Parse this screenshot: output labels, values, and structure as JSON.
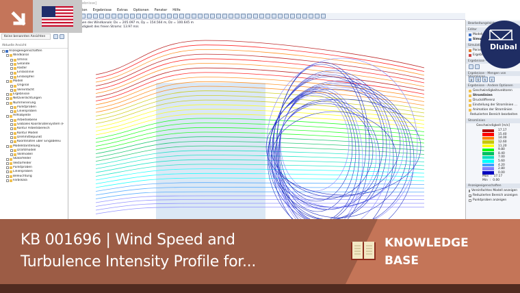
{
  "window": {
    "title_fragment": "ebnisse]"
  },
  "menu": [
    "tion",
    "Ergebnisse",
    "Extras",
    "Optionen",
    "Fenster",
    "Hilfe"
  ],
  "left_panel": {
    "views_select": "Keine benannten Ansichten",
    "section": "Aktuelle Ansicht",
    "tree": [
      {
        "label": "Anzeigeeigenschaften",
        "level": 0
      },
      {
        "label": "Windkanal",
        "level": 1
      },
      {
        "label": "Umriss",
        "level": 2
      },
      {
        "label": "Gelände",
        "level": 2
      },
      {
        "label": "Raster",
        "level": 2
      },
      {
        "label": "Einlasslinie",
        "level": 2
      },
      {
        "label": "Einlasspfeil",
        "level": 2
      },
      {
        "label": "Modell",
        "level": 1
      },
      {
        "label": "Original",
        "level": 2
      },
      {
        "label": "Vereinfacht",
        "level": 2
      },
      {
        "label": "Ergebnisse",
        "level": 1
      },
      {
        "label": "Netzverdichtungen",
        "level": 1
      },
      {
        "label": "Nummerierung",
        "level": 1
      },
      {
        "label": "Punktproben",
        "level": 2
      },
      {
        "label": "Linienproben",
        "level": 2
      },
      {
        "label": "Hilfsobjekte",
        "level": 1
      },
      {
        "label": "Arbeitsebene",
        "level": 2
      },
      {
        "label": "Globales Koordinatensystem (F",
        "level": 2
      },
      {
        "label": "Kontur Arbeitsbereich",
        "level": 2
      },
      {
        "label": "Kontur Modell",
        "level": 2
      },
      {
        "label": "Drehmittelpunkt",
        "level": 2
      },
      {
        "label": "Koordinaten über Eingabeleu",
        "level": 2
      },
      {
        "label": "Modelldarstellung",
        "level": 1
      },
      {
        "label": "Drahtmodell",
        "level": 2
      },
      {
        "label": "Vollmodell",
        "level": 2
      },
      {
        "label": "Skalarfelder",
        "level": 1
      },
      {
        "label": "Vektorfelder",
        "level": 1
      },
      {
        "label": "Punktproben",
        "level": 1
      },
      {
        "label": "Linienproben",
        "level": 1
      },
      {
        "label": "Beleuchtung",
        "level": 1
      },
      {
        "label": "Farbskala",
        "level": 1
      }
    ]
  },
  "info": {
    "line1": "nen des Windkanals: Dx = 205.097 m, Dy = 154.564 m, Dz = 100.645 m",
    "line2": "ndigkeit des freien Stroms: 13.97 m/s"
  },
  "right_panel": {
    "title": "Bearbeitungsleiste",
    "editor_header": "Editor",
    "editor_items": [
      "Modell",
      "Simulation"
    ],
    "sim_header": "Simulation",
    "sim_items": [
      "Parameter",
      "Ergebnisse"
    ],
    "surf_header": "Ergebnisse - Flächenmengen",
    "stream_header": "Ergebnisse - Mengen von Stromlinien",
    "stream_buttons": [
      "p",
      "U",
      "k",
      "ε"
    ],
    "other_header": "Ergebnisse - Andere Optionen",
    "other_items": [
      "Geschwindigkeitsvektoren",
      "Stromlinien",
      "Druckdifferenz",
      "Einstellung der Stromlinien ...",
      "Animation der Stromlinien",
      "Reduzierten Bereich bearbeiten"
    ],
    "legend_header": "Stromlinien",
    "legend_title": "Geschwindigkeit [m/s]",
    "legend": [
      {
        "value": "17.17",
        "color": "#b00000"
      },
      {
        "value": "15.40",
        "color": "#ff0000"
      },
      {
        "value": "14.00",
        "color": "#ff8000"
      },
      {
        "value": "12.60",
        "color": "#c8c800"
      },
      {
        "value": "11.20",
        "color": "#ffff00"
      },
      {
        "value": "9.80",
        "color": "#00ff00"
      },
      {
        "value": "8.40",
        "color": "#00c060"
      },
      {
        "value": "7.00",
        "color": "#00e0c0"
      },
      {
        "value": "5.60",
        "color": "#00ffff"
      },
      {
        "value": "4.20",
        "color": "#40a0ff"
      },
      {
        "value": "2.80",
        "color": "#8080ff"
      },
      {
        "value": "0.00",
        "color": "#0000c0"
      }
    ],
    "max_label": "Max",
    "max_value": "17.17",
    "min_label": "Min",
    "min_value": "0.00",
    "display_header": "Anzeigeeigenschaften",
    "display_items": [
      {
        "label": "Vereinfachtes Modell anzeigen",
        "checked": false
      },
      {
        "label": "Reduzierten Bereich anzeigen",
        "checked": true
      },
      {
        "label": "Punktproben anzeigen",
        "checked": false
      }
    ]
  },
  "logo": "Dlubal",
  "banner": {
    "line1": "KB 001696 | Wind Speed and",
    "line2": "Turbulence Intensity Profile for...",
    "category_line1": "KNOWLEDGE",
    "category_line2": "BASE"
  },
  "colors": {
    "banner_left": "#9c5c45",
    "banner_right": "#c47558",
    "banner_bottom": "#512b20",
    "logo_bg": "#1f2d63"
  }
}
